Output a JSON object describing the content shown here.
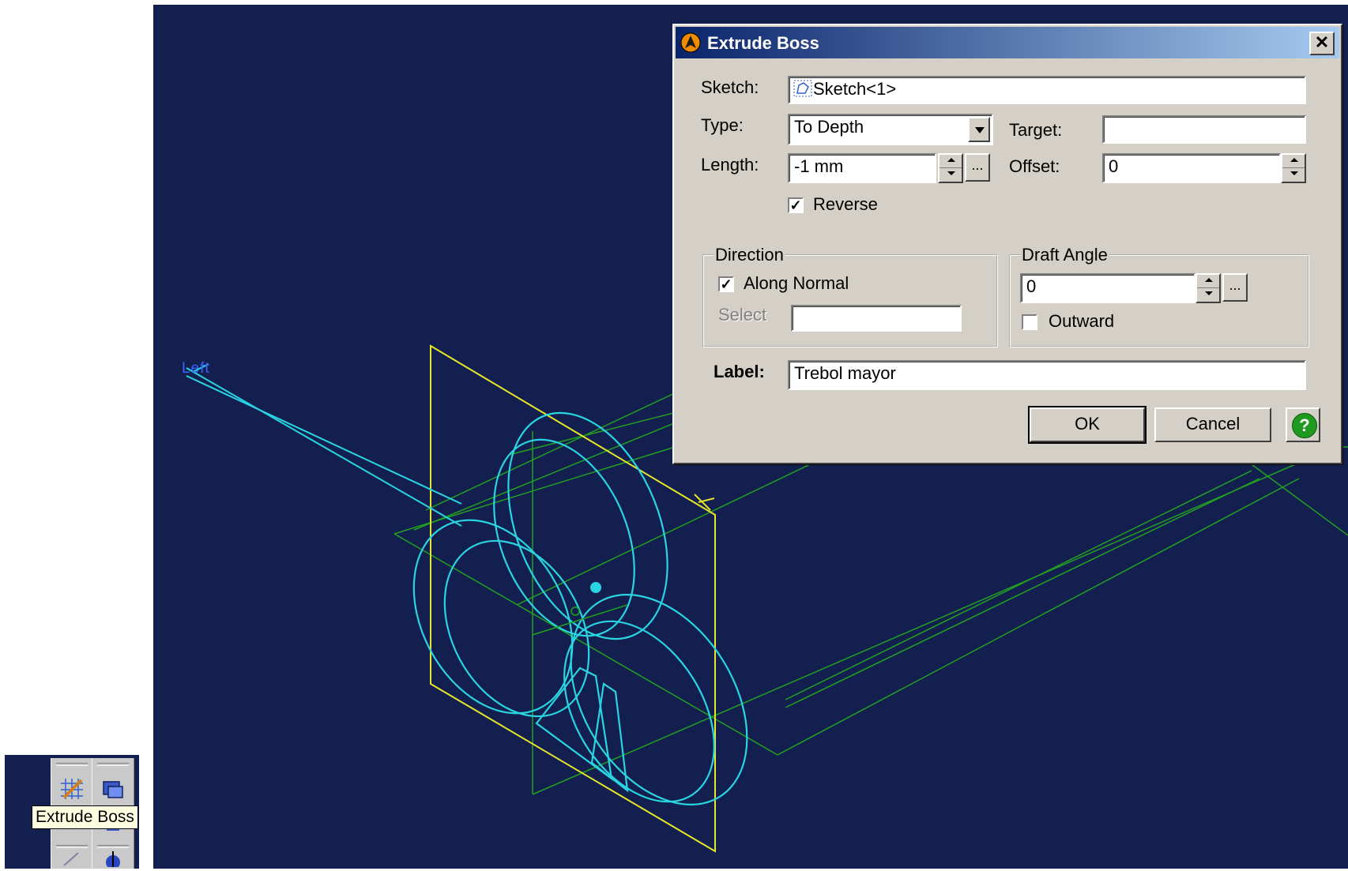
{
  "viewport": {
    "axis_label": "Left",
    "colors": {
      "background": "#131f4f",
      "sketch": "#2ad4e0",
      "plane": "#e6e62a",
      "grid": "#22a022"
    }
  },
  "toolbar": {
    "buttons": [
      "sketch-grid-icon",
      "extrude-boss-icon",
      "line-icon",
      "revolve-icon"
    ],
    "tooltip": "Extrude Boss"
  },
  "dialog": {
    "title": "Extrude Boss",
    "close_label": "✕",
    "sketch_label": "Sketch:",
    "sketch_value": "Sketch<1>",
    "type_label": "Type:",
    "type_value": "To Depth",
    "target_label": "Target:",
    "target_value": "",
    "length_label": "Length:",
    "length_value": "-1 mm",
    "offset_label": "Offset:",
    "offset_value": "0",
    "dots_label": "...",
    "reverse_label": "Reverse",
    "reverse_checked": true,
    "direction_title": "Direction",
    "along_normal_label": "Along Normal",
    "along_normal_checked": true,
    "select_label": "Select",
    "select_value": "",
    "draft_title": "Draft Angle",
    "draft_value": "0",
    "outward_label": "Outward",
    "outward_checked": false,
    "label_label": "Label:",
    "label_value": "Trebol mayor",
    "ok_label": "OK",
    "cancel_label": "Cancel",
    "help_label": "?"
  }
}
